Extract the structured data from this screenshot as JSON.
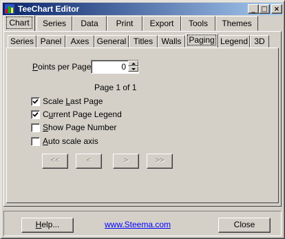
{
  "window": {
    "title": "TeeChart Editor"
  },
  "caption_buttons": {
    "minimize": "_",
    "maximize": "□",
    "close": "×"
  },
  "main_tabs": [
    "Chart",
    "Series",
    "Data",
    "Print",
    "Export",
    "Tools",
    "Themes"
  ],
  "main_tab_active": "Chart",
  "sub_tabs": [
    "Series",
    "Panel",
    "Axes",
    "General",
    "Titles",
    "Walls",
    "Paging",
    "Legend",
    "3D"
  ],
  "sub_tab_active": "Paging",
  "paging": {
    "points_per_page_label": {
      "pre": "",
      "mnemonic": "P",
      "post": "oints per Page:"
    },
    "points_per_page_value": "0",
    "page_status": "Page 1 of 1",
    "options": [
      {
        "pre": "Scale ",
        "mnemonic": "L",
        "post": "ast Page",
        "checked": true
      },
      {
        "pre": "C",
        "mnemonic": "u",
        "post": "rrent Page Legend",
        "checked": true
      },
      {
        "pre": "",
        "mnemonic": "S",
        "post": "how Page Number",
        "checked": false
      },
      {
        "pre": "",
        "mnemonic": "A",
        "post": "uto scale axis",
        "checked": false
      }
    ],
    "nav_buttons": [
      "<<",
      "<",
      ">",
      ">>"
    ]
  },
  "footer": {
    "help": {
      "mnemonic": "H",
      "post": "elp..."
    },
    "link": "www.Steema.com",
    "close": "Close"
  }
}
